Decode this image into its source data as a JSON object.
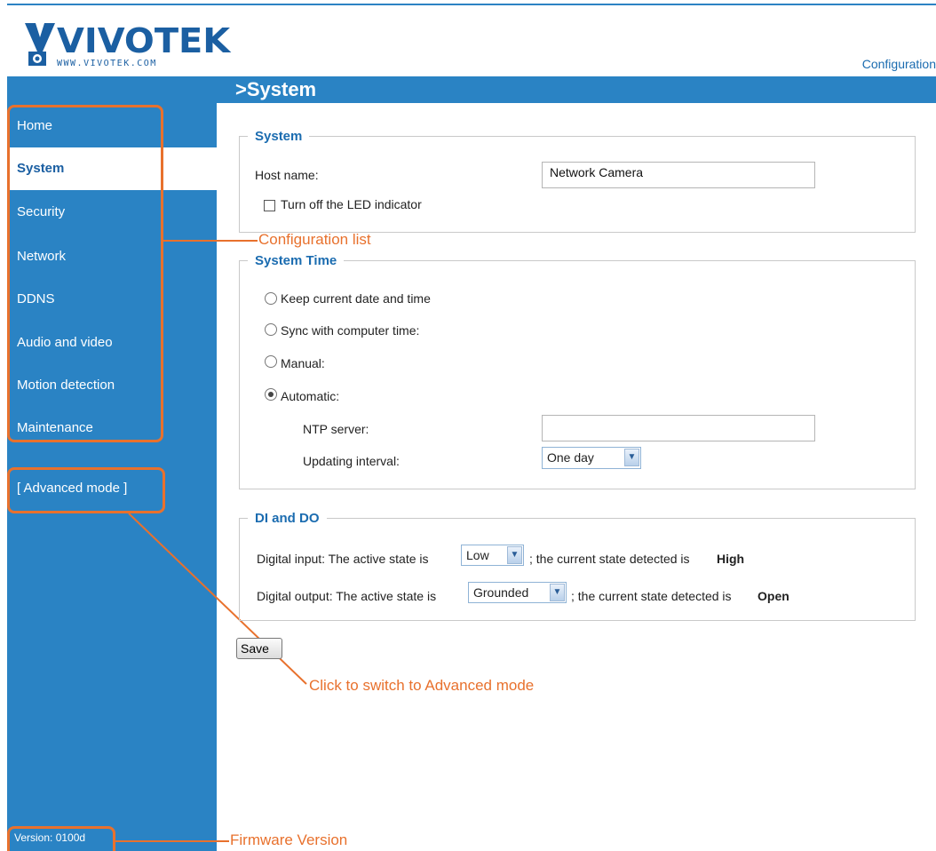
{
  "header": {
    "brand": "VIVOTEK",
    "brand_url": "WWW.VIVOTEK.COM",
    "config_link": "Configuration",
    "page_title": ">System"
  },
  "sidebar": {
    "items": [
      {
        "label": "Home",
        "active": false
      },
      {
        "label": "System",
        "active": true
      },
      {
        "label": "Security",
        "active": false
      },
      {
        "label": "Network",
        "active": false
      },
      {
        "label": "DDNS",
        "active": false
      },
      {
        "label": "Audio and video",
        "active": false
      },
      {
        "label": "Motion detection",
        "active": false
      },
      {
        "label": "Maintenance",
        "active": false
      }
    ],
    "advanced_mode": "[ Advanced mode ]",
    "version": "Version: 0100d"
  },
  "system": {
    "legend": "System",
    "host_label": "Host name:",
    "host_value": "Network Camera",
    "led_label": "Turn off the LED indicator",
    "led_checked": false
  },
  "system_time": {
    "legend": "System Time",
    "options": [
      {
        "label": "Keep current date and time",
        "selected": false
      },
      {
        "label": "Sync with computer time:",
        "selected": false
      },
      {
        "label": "Manual:",
        "selected": false
      },
      {
        "label": "Automatic:",
        "selected": true
      }
    ],
    "ntp_label": "NTP server:",
    "ntp_value": "",
    "interval_label": "Updating interval:",
    "interval_value": "One day"
  },
  "dido": {
    "legend": "DI and DO",
    "di_prefix": "Digital input: The active state is",
    "di_value": "Low",
    "di_suffix": "; the current state detected is",
    "di_state": "High",
    "do_prefix": "Digital output: The active state is",
    "do_value": "Grounded",
    "do_suffix": "; the current state detected is",
    "do_state": "Open"
  },
  "save_label": "Save",
  "annotations": {
    "config_list": "Configuration list",
    "advanced": "Click to switch to Advanced mode",
    "firmware": "Firmware Version"
  },
  "colors": {
    "sidebar": "#2a83c4",
    "accent": "#1b6cb0",
    "annotation": "#e8712d"
  }
}
